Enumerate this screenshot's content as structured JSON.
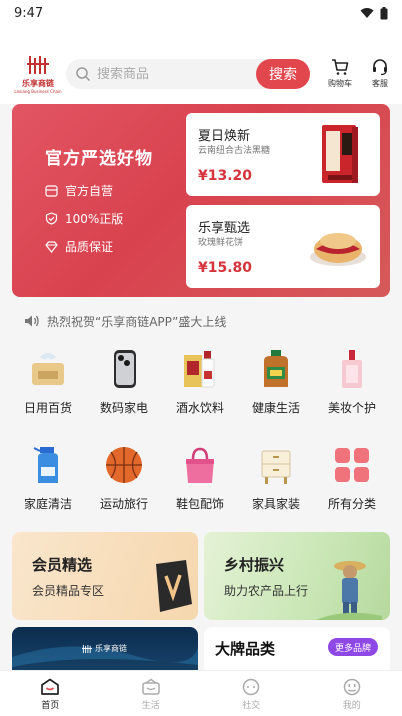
{
  "status": {
    "time": "9:47"
  },
  "header": {
    "logo_text": "乐享商链",
    "logo_sub": "Lexiang Business Chain",
    "search_placeholder": "搜索商品",
    "search_button": "搜索",
    "cart_label": "购物车",
    "service_label": "客服"
  },
  "banner": {
    "title": "官方严选好物",
    "features": [
      "官方自营",
      "100%正版",
      "品质保证"
    ],
    "products": [
      {
        "name": "夏日焕新",
        "desc": "云南纽合古法黑糖",
        "price": "¥13.20"
      },
      {
        "name": "乐享甄选",
        "desc": "玫瑰鲜花饼",
        "price": "¥15.80"
      }
    ]
  },
  "notice": {
    "text": "热烈祝贺“乐享商链APP”盛大上线"
  },
  "categories": [
    {
      "label": "日用百货",
      "icon": "tissue-box-icon"
    },
    {
      "label": "数码家电",
      "icon": "smartphone-icon"
    },
    {
      "label": "酒水饮料",
      "icon": "liquor-icon"
    },
    {
      "label": "健康生活",
      "icon": "oil-bottle-icon"
    },
    {
      "label": "美妆个护",
      "icon": "perfume-icon"
    },
    {
      "label": "家庭清洁",
      "icon": "cleaner-spray-icon"
    },
    {
      "label": "运动旅行",
      "icon": "basketball-icon"
    },
    {
      "label": "鞋包配饰",
      "icon": "handbag-icon"
    },
    {
      "label": "家具家装",
      "icon": "nightstand-icon"
    },
    {
      "label": "所有分类",
      "icon": "grid-icon"
    }
  ],
  "promos": [
    {
      "title": "会员精选",
      "subtitle": "会员精品专区"
    },
    {
      "title": "乡村振兴",
      "subtitle": "助力农产品上行"
    }
  ],
  "brand": {
    "title": "大牌品类",
    "more": "更多品牌"
  },
  "tabs": [
    {
      "label": "首页"
    },
    {
      "label": "生活"
    },
    {
      "label": "社交"
    },
    {
      "label": "我的"
    }
  ],
  "colors": {
    "accent": "#e2474d",
    "price": "#d6343c",
    "brand_more": "#8e48e6"
  }
}
